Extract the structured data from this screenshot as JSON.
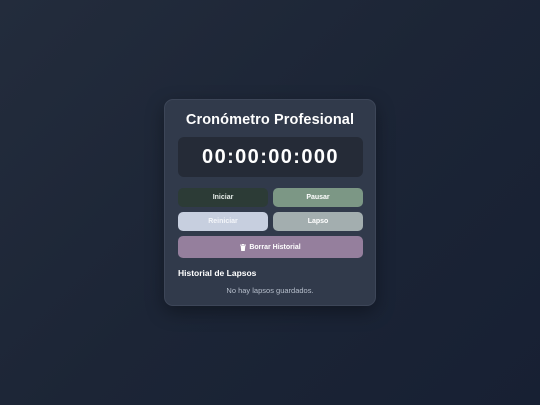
{
  "app": {
    "title": "Cronómetro Profesional"
  },
  "display": {
    "time": "00:00:00:000"
  },
  "controls": {
    "start_label": "Iniciar",
    "pause_label": "Pausar",
    "reset_label": "Reiniciar",
    "lap_label": "Lapso",
    "clear_label": "Borrar Historial",
    "clear_icon": "trash-icon"
  },
  "history": {
    "title": "Historial de Lapsos",
    "empty_message": "No hay lapsos guardados."
  },
  "colors": {
    "start": "#2c3b36",
    "pause": "#7c9785",
    "reset": "#c7cfdf",
    "lap": "#a3aeaf",
    "clear": "#957f9d"
  }
}
